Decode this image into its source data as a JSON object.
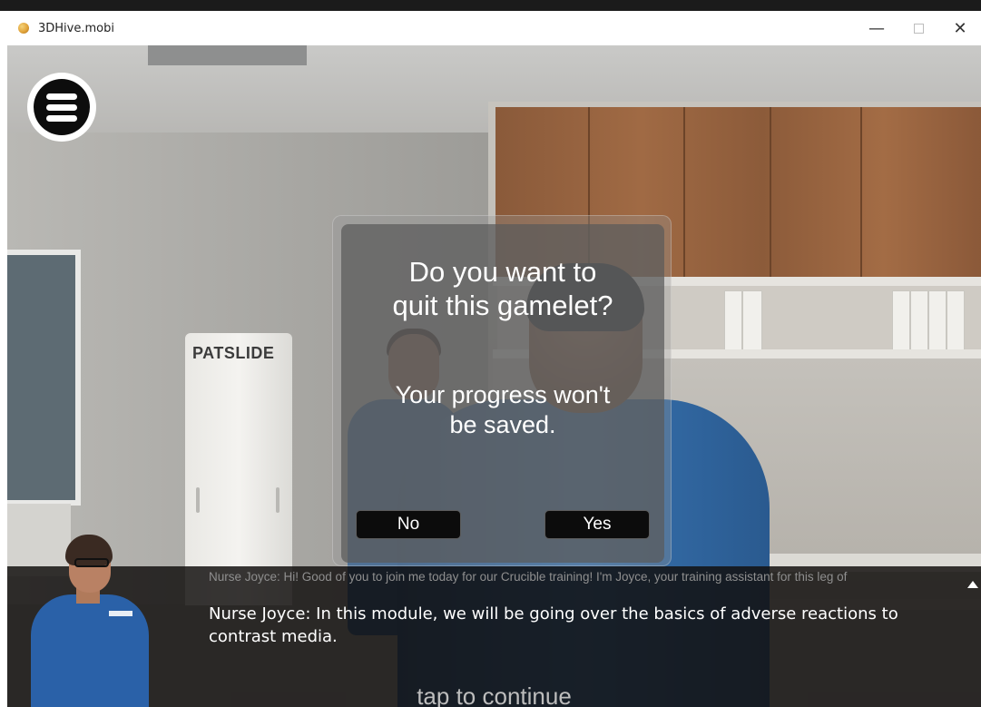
{
  "window": {
    "title": "3DHive.mobi",
    "controls": {
      "minimize": "—",
      "maximize": "☐",
      "close": "✕"
    },
    "icon": "app-logo-icon"
  },
  "scene": {
    "sign_text": "PATSLIDE"
  },
  "menu": {
    "icon": "hamburger-menu-icon"
  },
  "dialog": {
    "title_line1": "Do you want to",
    "title_line2": "quit this gamelet?",
    "message_line1": "Your progress won't",
    "message_line2": "be saved.",
    "no_label": "No",
    "yes_label": "Yes"
  },
  "subtitles": {
    "previous": "Nurse Joyce: Hi! Good of you to join me today for our Crucible training! I'm Joyce, your training assistant for this leg of",
    "current": "Nurse Joyce: In this module, we will be going over the basics of adverse reactions to contrast media.",
    "tap_to_continue": "tap to continue"
  }
}
